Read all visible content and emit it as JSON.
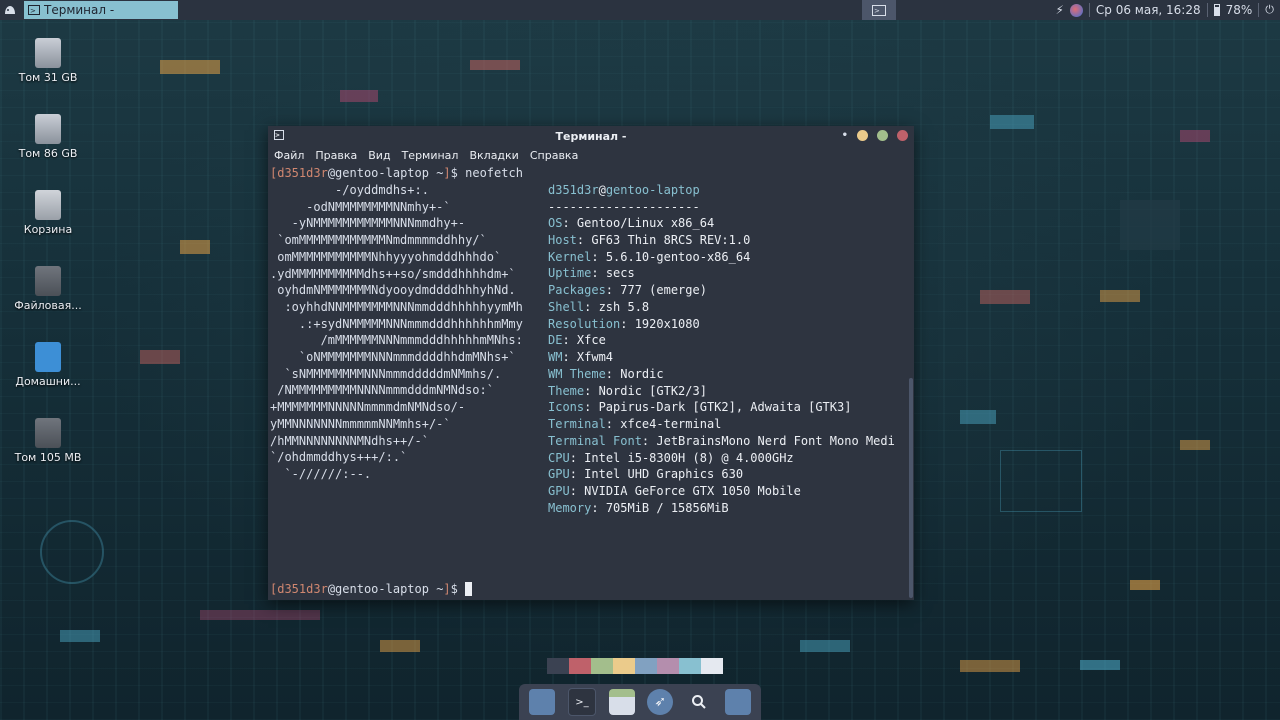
{
  "top_panel": {
    "task_title": "Терминал -",
    "clock": "Ср 06 мая, 16:28",
    "battery": "78%"
  },
  "desktop_icons": [
    {
      "label": "Том 31 GB"
    },
    {
      "label": "Том 86 GB"
    },
    {
      "label": "Корзина"
    },
    {
      "label": "Файловая..."
    },
    {
      "label": "Домашни..."
    },
    {
      "label": "Том 105 MB"
    }
  ],
  "terminal": {
    "title": "Терминал -",
    "menu": [
      "Файл",
      "Правка",
      "Вид",
      "Терминал",
      "Вкладки",
      "Справка"
    ],
    "prompt": {
      "user": "d351d3r",
      "at": "@",
      "host": "gentoo-laptop",
      "path": " ~",
      "symbol": "$"
    },
    "command": "neofetch",
    "logo": [
      "         -/oyddmdhs+:.",
      "     -odNMMMMMMMMNNmhy+-`",
      "   -yNMMMMMMMMMMMNNNmmdhy+-",
      " `omMMMMMMMMMMMMNmdmmmmddhhy/`",
      " omMMMMMMMMMMMNhhyyyohmdddhhhdo`",
      ".ydMMMMMMMMMMdhs++so/smdddhhhhdm+`",
      " oyhdmNMMMMMMMNdyooydmddddhhhyhNd.",
      "  :oyhhdNNMMMMMMMNNNmmdddhhhhhyymMh",
      "    .:+sydNMMMMMNNNmmmdddhhhhhhmMmy",
      "       /mMMMMMMNNNmmmdddhhhhhmMNhs:",
      "    `oNMMMMMMMNNNmmmddddhhdmMNhs+`",
      "  `sNMMMMMMMMNNNmmmdddddmNMmhs/.",
      " /NMMMMMMMMMNNNNmmmdddmNMNdso:`",
      "+MMMMMMMNNNNNmmmmdmNMNdso/-",
      "yMMNNNNNNNmmmmmNNMmhs+/-`",
      "/hMMNNNNNNNNMNdhs++/-`",
      "`/ohdmmddhys+++/:.`",
      "  `-//////:--."
    ],
    "info_header": {
      "user": "d351d3r",
      "host": "gentoo-laptop"
    },
    "separator": "---------------------",
    "info": [
      {
        "key": "OS",
        "value": "Gentoo/Linux x86_64"
      },
      {
        "key": "Host",
        "value": "GF63 Thin 8RCS REV:1.0"
      },
      {
        "key": "Kernel",
        "value": "5.6.10-gentoo-x86_64"
      },
      {
        "key": "Uptime",
        "value": "secs"
      },
      {
        "key": "Packages",
        "value": "777 (emerge)"
      },
      {
        "key": "Shell",
        "value": "zsh 5.8"
      },
      {
        "key": "Resolution",
        "value": "1920x1080"
      },
      {
        "key": "DE",
        "value": "Xfce"
      },
      {
        "key": "WM",
        "value": "Xfwm4"
      },
      {
        "key": "WM Theme",
        "value": "Nordic"
      },
      {
        "key": "Theme",
        "value": "Nordic [GTK2/3]"
      },
      {
        "key": "Icons",
        "value": "Papirus-Dark [GTK2], Adwaita [GTK3]"
      },
      {
        "key": "Terminal",
        "value": "xfce4-terminal"
      },
      {
        "key": "Terminal Font",
        "value": "JetBrainsMono Nerd Font Mono Medi"
      },
      {
        "key": "CPU",
        "value": "Intel i5-8300H (8) @ 4.000GHz"
      },
      {
        "key": "GPU",
        "value": "Intel UHD Graphics 630"
      },
      {
        "key": "GPU",
        "value": "NVIDIA GeForce GTX 1050 Mobile"
      },
      {
        "key": "Memory",
        "value": "705MiB / 15856MiB"
      }
    ],
    "colors": [
      "#3b4252",
      "#bf616a",
      "#a3be8c",
      "#ebcb8b",
      "#81a1c1",
      "#b48ead",
      "#88c0d0",
      "#e5e9f0"
    ],
    "window_buttons": [
      "#ebcb8b",
      "#a3be8c",
      "#bf616a"
    ]
  },
  "dock": {
    "items": [
      "show-desktop-icon",
      "terminal-icon",
      "file-manager-icon",
      "browser-icon",
      "search-icon",
      "folder-icon"
    ]
  }
}
